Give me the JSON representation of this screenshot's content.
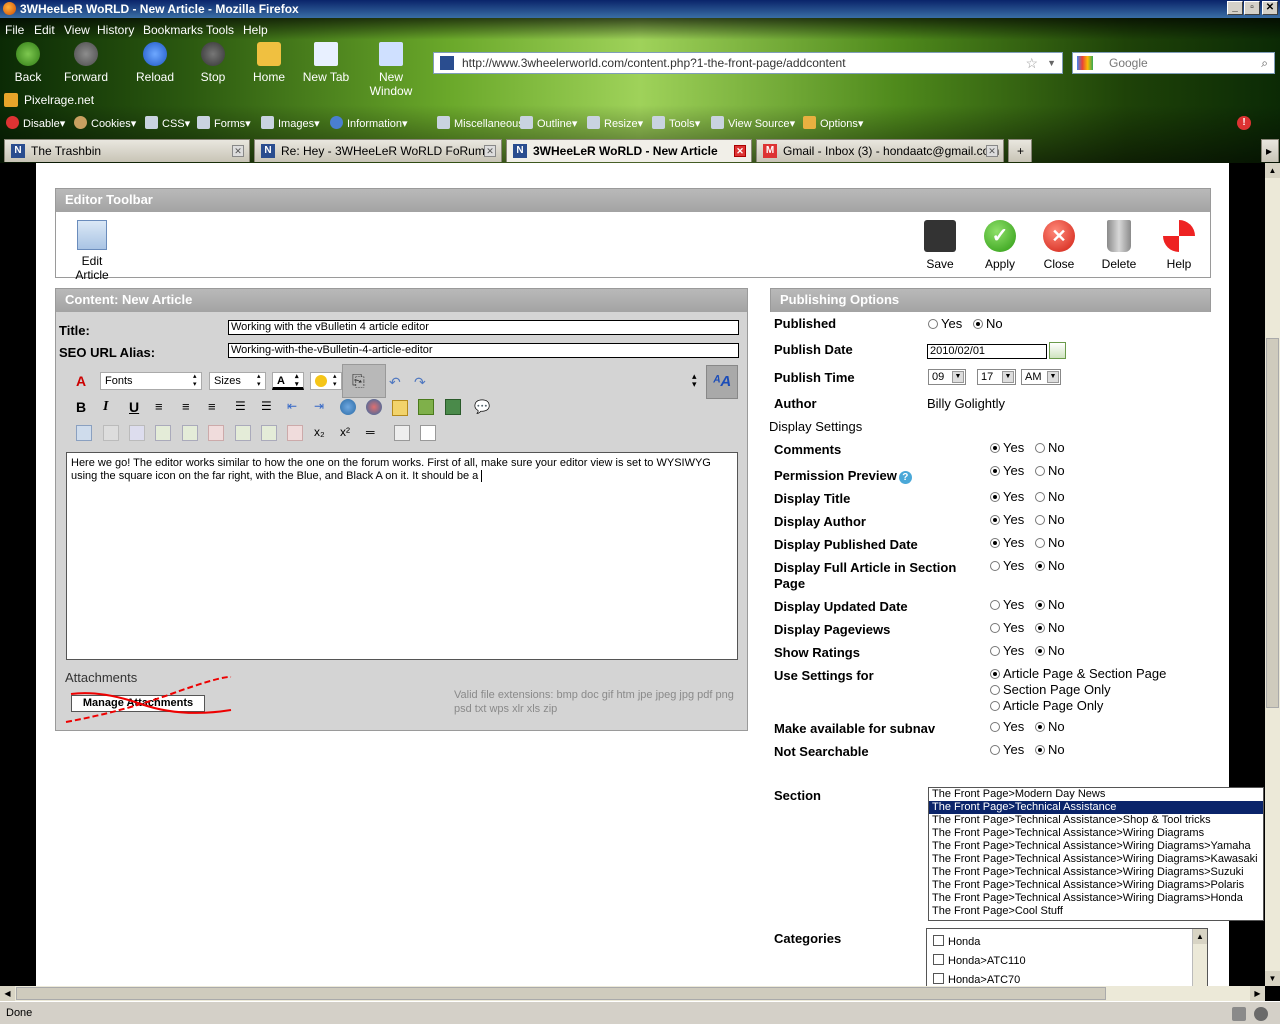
{
  "window": {
    "title": "3WHeeLeR WoRLD - New Article - Mozilla Firefox"
  },
  "menu": [
    "File",
    "Edit",
    "View",
    "History",
    "Bookmarks",
    "Tools",
    "Help"
  ],
  "nav": {
    "back": "Back",
    "forward": "Forward",
    "reload": "Reload",
    "stop": "Stop",
    "home": "Home",
    "new_tab": "New Tab",
    "new_window": "New Window"
  },
  "url": "http://www.3wheelerworld.com/content.php?1-the-front-page/addcontent",
  "search_placeholder": "Google",
  "bookmark": "Pixelrage.net",
  "webdev": [
    "Disable",
    "Cookies",
    "CSS",
    "Forms",
    "Images",
    "Information",
    "Miscellaneous",
    "Outline",
    "Resize",
    "Tools",
    "View Source",
    "Options"
  ],
  "tabs": [
    "The Trashbin",
    "Re: Hey - 3WHeeLeR WoRLD FoRums",
    "3WHeeLeR WoRLD - New Article",
    "Gmail - Inbox (3) - hondaatc@gmail.com"
  ],
  "editor_toolbar": {
    "title": "Editor Toolbar",
    "edit_article": "Edit Article",
    "save": "Save",
    "apply": "Apply",
    "close": "Close",
    "delete": "Delete",
    "help": "Help"
  },
  "content": {
    "header": "Content: New Article",
    "title_label": "Title:",
    "title_value": "Working with the vBulletin 4 article editor",
    "seo_label": "SEO URL Alias:",
    "seo_value": "Working-with-the-vBulletin-4-article-editor",
    "fonts": "Fonts",
    "sizes": "Sizes",
    "body": "Here we go! The editor works similar to how the one on the forum works. First of all, make sure your editor view is set to WYSIWYG using the square icon on the far right, with the Blue, and Black A on it. It should be a",
    "attachments_label": "Attachments",
    "manage_attachments": "Manage Attachments",
    "valid_ext": "Valid file extensions: bmp doc gif htm jpe jpeg jpg pdf png psd txt wps xlr xls zip"
  },
  "publishing": {
    "header": "Publishing Options",
    "published": "Published",
    "yes": "Yes",
    "no": "No",
    "publish_date": "Publish Date",
    "date_value": "2010/02/01",
    "publish_time": "Publish Time",
    "hour": "09",
    "minute": "17",
    "ampm": "AM",
    "author": "Author",
    "author_name": "Billy Golightly",
    "display_settings": "Display Settings",
    "settings": [
      {
        "label": "Comments",
        "value": "Yes"
      },
      {
        "label": "Permission Preview",
        "value": "Yes"
      },
      {
        "label": "Display Title",
        "value": "Yes"
      },
      {
        "label": "Display Author",
        "value": "Yes"
      },
      {
        "label": "Display Published Date",
        "value": "Yes"
      },
      {
        "label": "Display Full Article in Section Page",
        "value": "No"
      },
      {
        "label": "Display Updated Date",
        "value": "No"
      },
      {
        "label": "Display Pageviews",
        "value": "No"
      },
      {
        "label": "Show Ratings",
        "value": "No"
      }
    ],
    "use_settings_for": "Use Settings for",
    "use_options": [
      "Article Page & Section Page",
      "Section Page Only",
      "Article Page Only"
    ],
    "use_selected": "Article Page & Section Page",
    "subnav": "Make available for subnav",
    "subnav_value": "No",
    "not_searchable": "Not Searchable",
    "not_searchable_value": "No",
    "section": "Section",
    "sections": [
      "The Front Page>Modern Day News",
      "The Front Page>Technical Assistance",
      "The Front Page>Technical Assistance>Shop & Tool tricks",
      "The Front Page>Technical Assistance>Wiring Diagrams",
      "The Front Page>Technical Assistance>Wiring Diagrams>Yamaha",
      "The Front Page>Technical Assistance>Wiring Diagrams>Kawasaki",
      "The Front Page>Technical Assistance>Wiring Diagrams>Suzuki",
      "The Front Page>Technical Assistance>Wiring Diagrams>Polaris",
      "The Front Page>Technical Assistance>Wiring Diagrams>Honda",
      "The Front Page>Cool Stuff"
    ],
    "section_selected": "The Front Page>Technical Assistance",
    "categories": "Categories",
    "category_items": [
      "Honda",
      "Honda>ATC110",
      "Honda>ATC70"
    ]
  },
  "status": "Done",
  "colors": {
    "accent": "#0a246a",
    "panel_header": "#a9a9a9"
  }
}
